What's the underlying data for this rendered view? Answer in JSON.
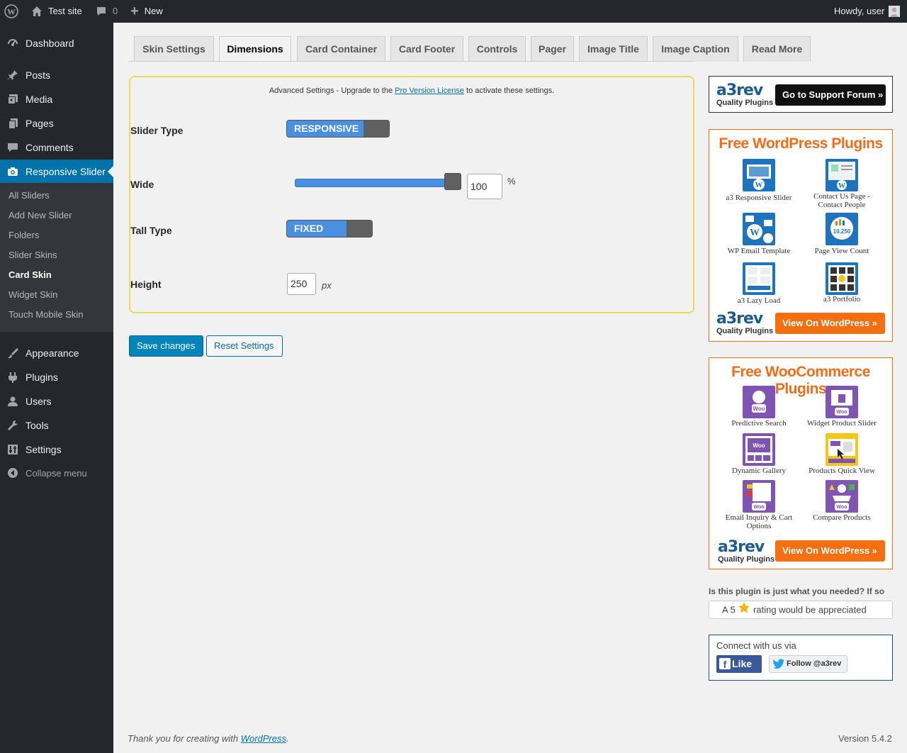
{
  "adminbar": {
    "site_name": "Test site",
    "comments_count": "0",
    "new_label": "New",
    "greeting": "Howdy, user"
  },
  "sidebar": {
    "items": [
      {
        "label": "Dashboard",
        "icon": "dashboard-icon"
      },
      {
        "label": "Posts",
        "icon": "pin-icon"
      },
      {
        "label": "Media",
        "icon": "media-icon"
      },
      {
        "label": "Pages",
        "icon": "pages-icon"
      },
      {
        "label": "Comments",
        "icon": "comment-icon"
      },
      {
        "label": "Responsive Slider",
        "icon": "camera-icon"
      },
      {
        "label": "Appearance",
        "icon": "brush-icon"
      },
      {
        "label": "Plugins",
        "icon": "plug-icon"
      },
      {
        "label": "Users",
        "icon": "user-icon"
      },
      {
        "label": "Tools",
        "icon": "wrench-icon"
      },
      {
        "label": "Settings",
        "icon": "sliders-icon"
      },
      {
        "label": "Collapse menu",
        "icon": "collapse-icon"
      }
    ],
    "submenu": [
      "All Sliders",
      "Add New Slider",
      "Folders",
      "Slider Skins",
      "Card Skin",
      "Widget Skin",
      "Touch Mobile Skin"
    ],
    "current_submenu": "Card Skin"
  },
  "tabs": [
    "Skin Settings",
    "Dimensions",
    "Card Container",
    "Card Footer",
    "Controls",
    "Pager",
    "Image Title",
    "Image Caption",
    "Read More"
  ],
  "active_tab": "Dimensions",
  "settings": {
    "note_prefix": "Advanced Settings - Upgrade to the ",
    "note_link": "Pro Version License",
    "note_suffix": " to activate these settings.",
    "slider_type_label": "Slider Type",
    "slider_type_value": "RESPONSIVE",
    "wide_label": "Wide",
    "wide_value": "100",
    "wide_unit": "%",
    "wide_fraction": 1.0,
    "tall_type_label": "Tall Type",
    "tall_type_value": "FIXED",
    "height_label": "Height",
    "height_value": "250",
    "height_unit": "px"
  },
  "buttons": {
    "save": "Save changes",
    "reset": "Reset Settings"
  },
  "sidebar_panels": {
    "logo_big": "a3rev",
    "logo_small": "Quality Plugins",
    "support_btn": "Go to Support Forum »",
    "wp_title": "Free WordPress Plugins",
    "wp_plugins": [
      "a3 Responsive Slider",
      "Contact Us Page - Contact People",
      "WP Email Template",
      "Page View Count",
      "a3 Lazy Load",
      "a3 Portfolio"
    ],
    "view_btn": "View On WordPress »",
    "woo_title": "Free WooCommerce Plugins",
    "woo_plugins": [
      "Predictive Search",
      "Widget Product Slider",
      "Dynamic Gallery",
      "Products Quick View",
      "Email Inquiry & Cart Options",
      "Compare Products"
    ],
    "woo_badge": "Woo",
    "rating_question": "Is this plugin is just what you needed? If so",
    "rating_prefix": "A 5",
    "rating_suffix": "rating would be appreciated",
    "connect_title": "Connect with us via",
    "like_btn": "Like",
    "follow_btn": "Follow @a3rev",
    "page_view_number": "10,250"
  },
  "footer": {
    "thanks_prefix": "Thank you for creating with ",
    "thanks_link": "WordPress",
    "thanks_suffix": ".",
    "version": "Version 5.4.2"
  },
  "colors": {
    "admin_dark": "#23282d",
    "accent_blue": "#0073aa",
    "toggle_blue": "#4a90e2",
    "orange": "#f56e0f",
    "woo_purple": "#7f54b3"
  }
}
